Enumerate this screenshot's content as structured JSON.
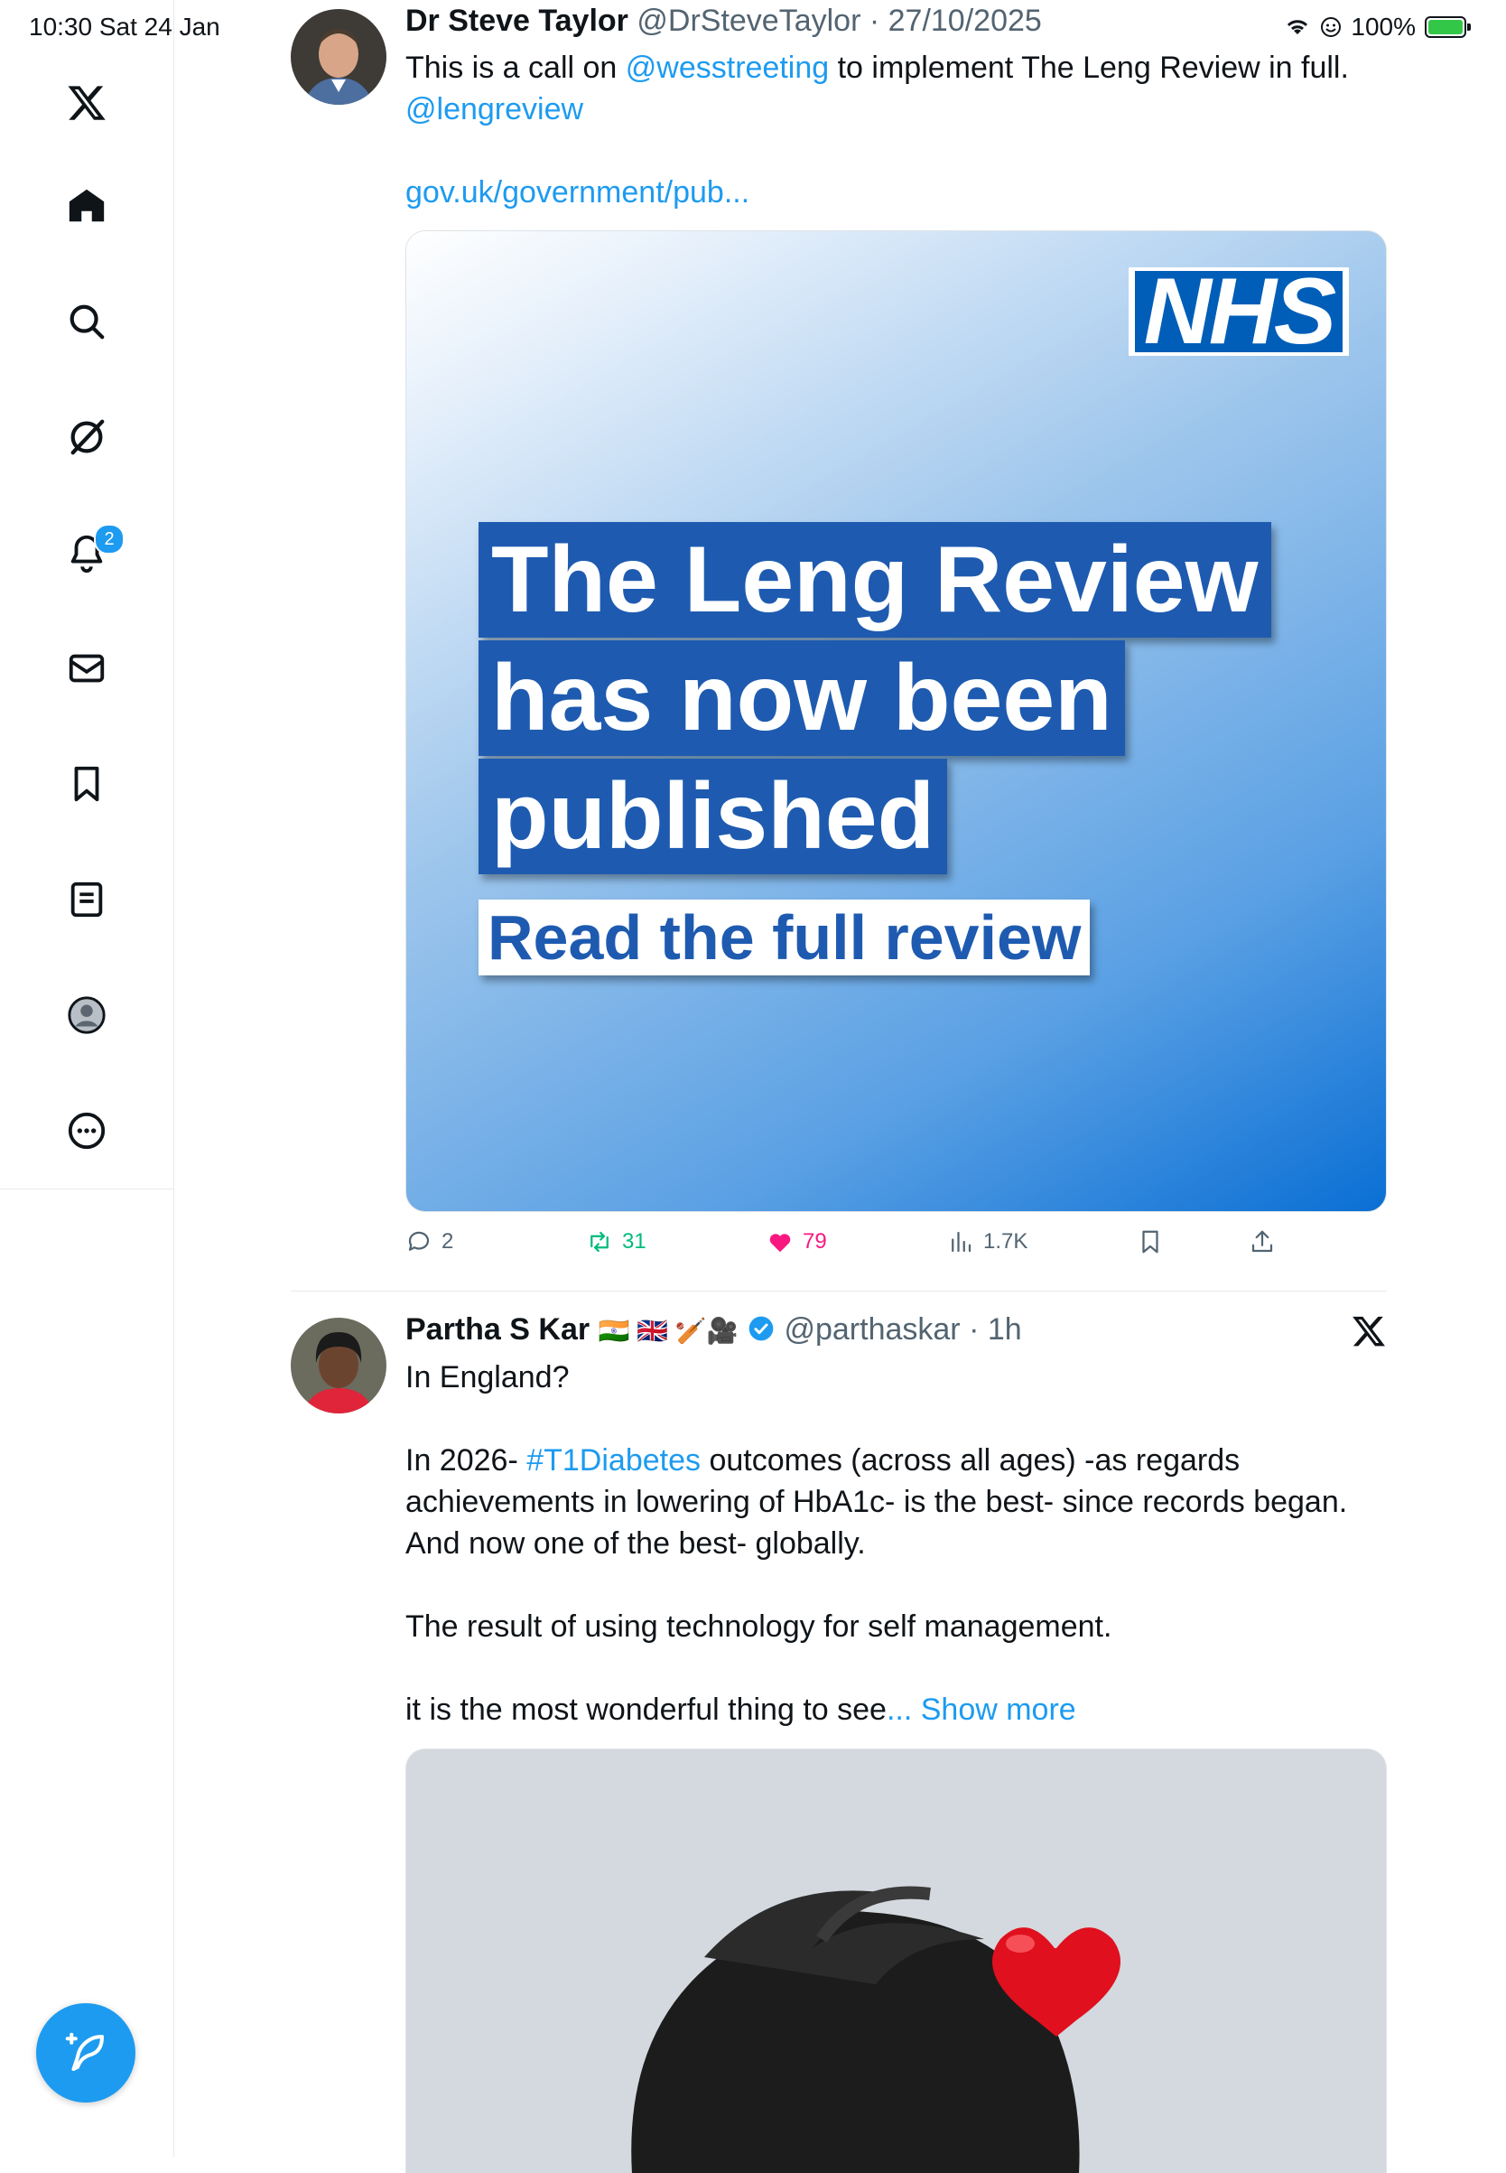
{
  "status_bar": {
    "time": "10:30  Sat 24 Jan",
    "battery": "100%"
  },
  "sidebar": {
    "notifications_badge": "2",
    "items": [
      {
        "name": "x-logo-icon"
      },
      {
        "name": "home-icon"
      },
      {
        "name": "search-icon"
      },
      {
        "name": "grok-icon"
      },
      {
        "name": "notifications-icon"
      },
      {
        "name": "messages-icon"
      },
      {
        "name": "bookmarks-icon"
      },
      {
        "name": "lists-icon"
      },
      {
        "name": "profile-icon"
      },
      {
        "name": "more-icon"
      }
    ]
  },
  "tweet1": {
    "name": "Dr Steve Taylor",
    "handle": "@DrSteveTaylor",
    "date": "27/10/2025",
    "text_before": "This is a call on ",
    "mention1": "@wesstreeting",
    "text_after": " to implement The Leng Review in full.",
    "mention2": "@lengreview",
    "link": "gov.uk/government/pub...",
    "card": {
      "logo": "NHS",
      "line1": "The Leng Review",
      "line2": "has now been",
      "line3": "published",
      "subtitle": "Read the full review"
    },
    "replies": "2",
    "reposts": "31",
    "likes": "79",
    "views": "1.7K"
  },
  "tweet2": {
    "name": "Partha S Kar",
    "emojis": "🇮🇳 🇬🇧 🏏🎥",
    "handle": "@parthaskar",
    "time": "1h",
    "p1": "In England?",
    "p2_before": "In 2026- ",
    "hashtag": "#T1Diabetes",
    "p2_after": " outcomes (across all ages) -as regards achievements in lowering of HbA1c- is the best- since records began. And now one of the best- globally.",
    "p3": "The result of using technology for self management.",
    "p4": "it is the most wonderful thing to see",
    "show_more": "... Show more"
  },
  "colors": {
    "accent": "#1d9bf0",
    "like": "#f91880",
    "repost": "#00ba7c",
    "nhs_blue": "#005eb8"
  }
}
